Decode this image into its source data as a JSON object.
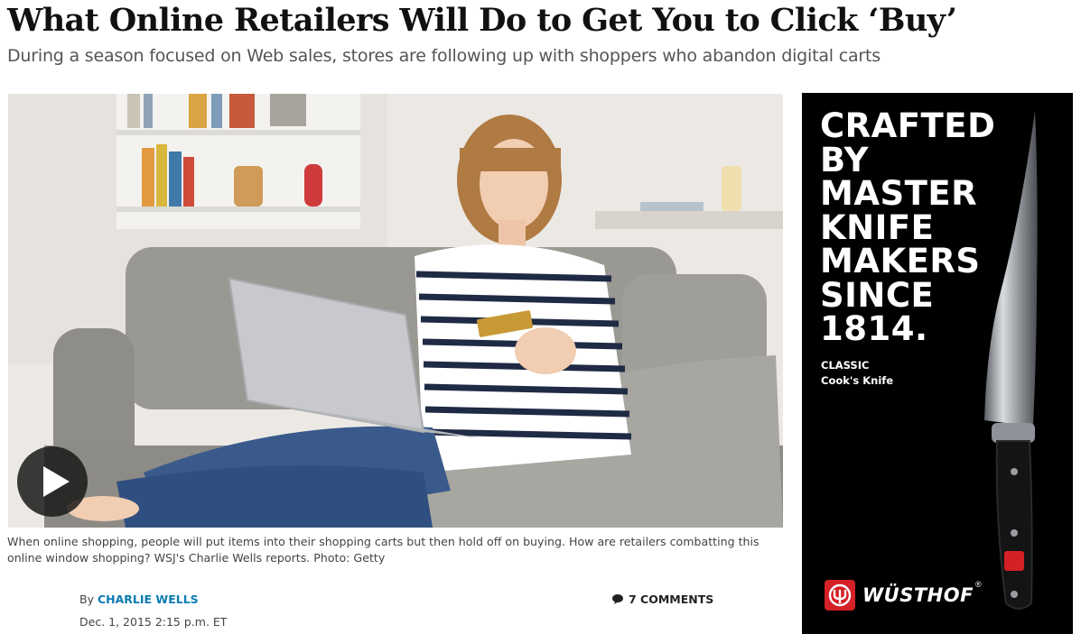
{
  "article": {
    "headline": "What Online Retailers Will Do to Get You to Click ‘Buy’",
    "dek": "During a season focused on Web sales, stores are following up with shoppers who abandon digital carts",
    "caption": "When online shopping, people will put items into their shopping carts but then hold off on buying. How are retailers combatting this online window shopping? WSJ's Charlie Wells reports. Photo: Getty",
    "byline_prefix": "By",
    "author": "CHARLIE WELLS",
    "timestamp": "Dec. 1, 2015 2:15 p.m. ET",
    "comments_label": "7 COMMENTS"
  },
  "video": {
    "play_icon": "play-icon"
  },
  "ad": {
    "headline_lines": [
      "CRAFTED",
      "BY",
      "MASTER",
      "KNIFE",
      "MAKERS",
      "SINCE",
      "1814."
    ],
    "product_line1": "CLASSIC",
    "product_line2": "Cook's Knife",
    "brand": "WÜSTHOF",
    "trademark": "®",
    "brand_color": "#d42027"
  },
  "colors": {
    "author_link": "#0a7bb2",
    "ad_background": "#000000"
  }
}
